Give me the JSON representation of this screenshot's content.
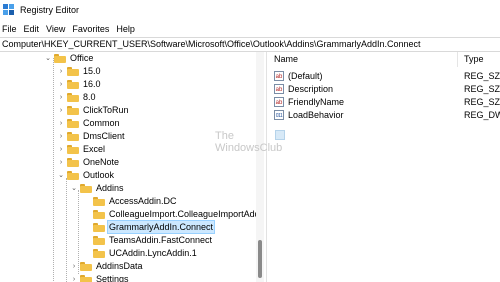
{
  "window": {
    "title": "Registry Editor",
    "icon": "registry-app-icon"
  },
  "menu": [
    "File",
    "Edit",
    "View",
    "Favorites",
    "Help"
  ],
  "address": "Computer\\HKEY_CURRENT_USER\\Software\\Microsoft\\Office\\Outlook\\Addins\\GrammarlyAddIn.Connect",
  "tree": [
    {
      "label": "Office",
      "expanded": true,
      "selected": false
    },
    {
      "label": "15.0",
      "expanded": false,
      "selected": false
    },
    {
      "label": "16.0",
      "expanded": false,
      "selected": false
    },
    {
      "label": "8.0",
      "expanded": false,
      "selected": false
    },
    {
      "label": "ClickToRun",
      "expanded": false,
      "selected": false
    },
    {
      "label": "Common",
      "expanded": false,
      "selected": false
    },
    {
      "label": "DmsClient",
      "expanded": false,
      "selected": false
    },
    {
      "label": "Excel",
      "expanded": false,
      "selected": false
    },
    {
      "label": "OneNote",
      "expanded": false,
      "selected": false
    },
    {
      "label": "Outlook",
      "expanded": true,
      "selected": false
    },
    {
      "label": "Addins",
      "expanded": true,
      "selected": false
    },
    {
      "label": "AccessAddin.DC",
      "expanded": false,
      "selected": false
    },
    {
      "label": "ColleagueImport.ColleagueImportAddi",
      "expanded": false,
      "selected": false
    },
    {
      "label": "GrammarlyAddIn.Connect",
      "expanded": false,
      "selected": true
    },
    {
      "label": "TeamsAddin.FastConnect",
      "expanded": false,
      "selected": false
    },
    {
      "label": "UCAddin.LyncAddin.1",
      "expanded": false,
      "selected": false
    },
    {
      "label": "AddinsData",
      "expanded": false,
      "selected": false
    },
    {
      "label": "Settings",
      "expanded": false,
      "selected": false
    }
  ],
  "values": {
    "columns": [
      "Name",
      "Type"
    ],
    "rows": [
      {
        "name": "(Default)",
        "type": "REG_SZ",
        "icon": "string-value-icon"
      },
      {
        "name": "Description",
        "type": "REG_SZ",
        "icon": "string-value-icon"
      },
      {
        "name": "FriendlyName",
        "type": "REG_SZ",
        "icon": "string-value-icon"
      },
      {
        "name": "LoadBehavior",
        "type": "REG_DWO",
        "icon": "dword-value-icon"
      }
    ]
  },
  "watermark": {
    "line1": "The",
    "line2": "WindowsClub"
  },
  "colors": {
    "selection": "#cce8ff",
    "folder": "#f3c34a"
  }
}
